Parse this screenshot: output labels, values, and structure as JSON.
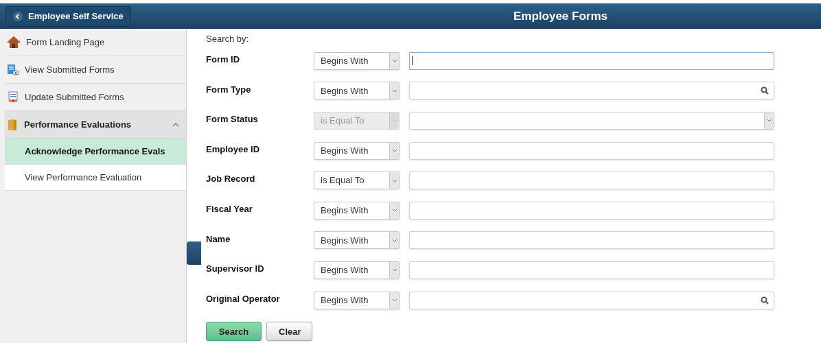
{
  "header": {
    "back_button": "Employee Self Service",
    "title": "Employee Forms"
  },
  "sidebar": {
    "items": [
      {
        "label": "Form Landing Page",
        "selected": false
      },
      {
        "label": "View Submitted Forms",
        "selected": false
      },
      {
        "label": "Update Submitted Forms",
        "selected": false
      }
    ],
    "group": {
      "label": "Performance Evaluations",
      "expanded": true,
      "children": [
        {
          "label": "Acknowledge Performance Evals",
          "selected": true
        },
        {
          "label": "View Performance Evaluation",
          "selected": false
        }
      ]
    }
  },
  "search": {
    "heading": "Search by:",
    "fields": [
      {
        "label": "Form ID",
        "operator": "Begins With",
        "operator_disabled": false,
        "kind": "text",
        "focused": true
      },
      {
        "label": "Form Type",
        "operator": "Begins With",
        "operator_disabled": false,
        "kind": "lookup",
        "focused": false
      },
      {
        "label": "Form Status",
        "operator": "is Equal To",
        "operator_disabled": true,
        "kind": "dropdown",
        "focused": false
      },
      {
        "label": "Employee ID",
        "operator": "Begins With",
        "operator_disabled": false,
        "kind": "text",
        "focused": false
      },
      {
        "label": "Job Record",
        "operator": "is Equal To",
        "operator_disabled": false,
        "kind": "text",
        "focused": false
      },
      {
        "label": "Fiscal Year",
        "operator": "Begins With",
        "operator_disabled": false,
        "kind": "text",
        "focused": false
      },
      {
        "label": "Name",
        "operator": "Begins With",
        "operator_disabled": false,
        "kind": "text",
        "focused": false
      },
      {
        "label": "Supervisor ID",
        "operator": "Begins With",
        "operator_disabled": false,
        "kind": "text",
        "focused": false
      },
      {
        "label": "Original Operator",
        "operator": "Begins With",
        "operator_disabled": false,
        "kind": "lookup",
        "focused": false
      }
    ],
    "buttons": [
      {
        "label": "Search",
        "kind": "primary"
      },
      {
        "label": "Clear",
        "kind": "secondary"
      }
    ]
  }
}
